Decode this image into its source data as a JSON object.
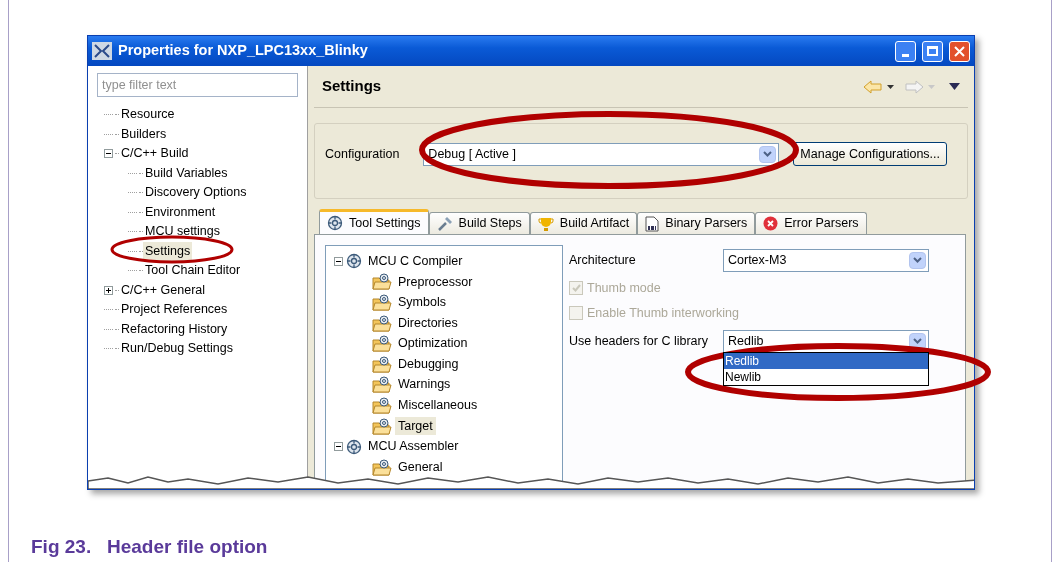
{
  "window": {
    "title": "Properties for NXP_LPC13xx_Blinky"
  },
  "filter": {
    "placeholder": "type filter text"
  },
  "nav": [
    {
      "label": "Resource",
      "selected": false
    },
    {
      "label": "Builders",
      "selected": false
    },
    {
      "label": "C/C++ Build",
      "selected": false,
      "expanded": true,
      "children": [
        {
          "label": "Build Variables",
          "selected": false
        },
        {
          "label": "Discovery Options",
          "selected": false
        },
        {
          "label": "Environment",
          "selected": false
        },
        {
          "label": "MCU settings",
          "selected": false
        },
        {
          "label": "Settings",
          "selected": true
        },
        {
          "label": "Tool Chain Editor",
          "selected": false
        }
      ]
    },
    {
      "label": "C/C++ General",
      "selected": false,
      "expanded": false
    },
    {
      "label": "Project References",
      "selected": false
    },
    {
      "label": "Refactoring History",
      "selected": false
    },
    {
      "label": "Run/Debug Settings",
      "selected": false
    }
  ],
  "page": {
    "title": "Settings"
  },
  "configuration": {
    "label": "Configuration",
    "value": "Debug  [ Active ]",
    "button": "Manage Configurations..."
  },
  "tabs": [
    {
      "label": "Tool Settings",
      "kind": "tool",
      "selected": true
    },
    {
      "label": "Build Steps",
      "kind": "steps",
      "selected": false
    },
    {
      "label": "Build Artifact",
      "kind": "artifact",
      "selected": false
    },
    {
      "label": "Binary Parsers",
      "kind": "binary",
      "selected": false
    },
    {
      "label": "Error Parsers",
      "kind": "error",
      "selected": false
    }
  ],
  "tools": [
    {
      "label": "MCU C Compiler",
      "expanded": true,
      "selected": false,
      "children": [
        {
          "label": "Preprocessor",
          "selected": false
        },
        {
          "label": "Symbols",
          "selected": false
        },
        {
          "label": "Directories",
          "selected": false
        },
        {
          "label": "Optimization",
          "selected": false
        },
        {
          "label": "Debugging",
          "selected": false
        },
        {
          "label": "Warnings",
          "selected": false
        },
        {
          "label": "Miscellaneous",
          "selected": false
        },
        {
          "label": "Target",
          "selected": true
        }
      ]
    },
    {
      "label": "MCU Assembler",
      "expanded": true,
      "selected": false,
      "children": [
        {
          "label": "General",
          "selected": false
        }
      ]
    }
  ],
  "options": [
    {
      "kind": "select",
      "label": "Architecture",
      "value": "Cortex-M3"
    },
    {
      "kind": "checkbox",
      "label": "Thumb mode",
      "checked": true,
      "disabled": true
    },
    {
      "kind": "checkbox",
      "label": "Enable Thumb interworking",
      "checked": false,
      "disabled": true
    },
    {
      "kind": "select",
      "label": "Use headers for C library",
      "value": "Redlib",
      "open": true,
      "choices": [
        {
          "label": "Redlib",
          "selected": true
        },
        {
          "label": "Newlib",
          "selected": false
        }
      ]
    }
  ],
  "caption": "Fig 23.   Header file option"
}
